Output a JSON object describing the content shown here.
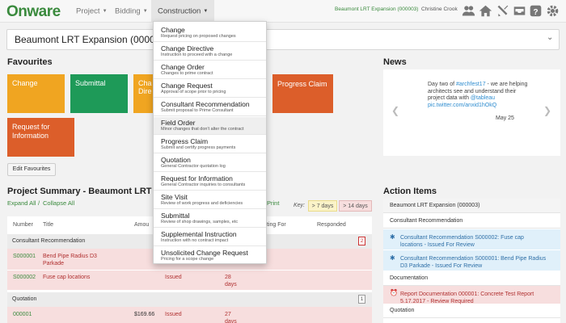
{
  "topbar": {
    "logo": "Onware",
    "nav": [
      {
        "label": "Project"
      },
      {
        "label": "Bidding"
      },
      {
        "label": "Construction"
      }
    ],
    "project_link": "Beaumont LRT Expansion (000003)",
    "user": "Christine Crook"
  },
  "project_selector": {
    "title": "Beaumont LRT Expansion (000003)"
  },
  "favourites": {
    "title": "Favourites",
    "tiles": [
      {
        "label": "Change",
        "color": "#f0a521"
      },
      {
        "label": "Submittal",
        "color": "#1e9a58"
      },
      {
        "label": "Cha Dire",
        "color": "#f0a521"
      },
      {
        "label": "Progress Claim",
        "color": "#dc5e2a"
      },
      {
        "label": "Request for Information",
        "color": "#dc5e2a"
      }
    ],
    "edit_button": "Edit Favourites"
  },
  "news": {
    "title": "News",
    "text_pre": "Day two of ",
    "hashtag": "#archfest17",
    "text_mid": " - we are helping architects see and understand their project data with ",
    "mention": "@tableau",
    "link": "pic.twitter.com/anxid1hOkQ",
    "date": "May 25"
  },
  "summary": {
    "title": "Project Summary - Beaumont LRT",
    "expand_all": "Expand All",
    "collapse_all": "Collapse All",
    "print": "Print",
    "key_label": "Key:",
    "key_7": "> 7 days",
    "key_14": "> 14 days",
    "columns": {
      "number": "Number",
      "title": "Title",
      "amount": "Amou",
      "waiting": "ting For",
      "responded": "Responded"
    },
    "groups": [
      {
        "name": "Consultant Recommendation",
        "count": "2",
        "rows": [
          {
            "number": "S000001",
            "title1": "Bend Pipe Radius D3",
            "title2": "Parkade"
          },
          {
            "number": "S000002",
            "title1": "Fuse cap locations",
            "status": "Issued",
            "days1": "28",
            "days2": "days"
          }
        ]
      },
      {
        "name": "Quotation",
        "count": "1",
        "rows": [
          {
            "number": "000001",
            "amount": "$169.66",
            "status": "Issued",
            "days1": "27",
            "days2": "days"
          }
        ]
      }
    ]
  },
  "action_items": {
    "title": "Action Items",
    "project": "Beaumont LRT Expansion (000003)",
    "sections": [
      {
        "name": "Consultant Recommendation"
      },
      {
        "name": "Documentation"
      },
      {
        "name": "Quotation"
      }
    ],
    "items": [
      {
        "line1": "Consultant Recommendation S000002: Fuse cap",
        "line2": "locations - Issued For Review"
      },
      {
        "line1": "Consultant Recommendation S000001: Bend Pipe Radius",
        "line2": "D3 Parkade - Issued For Review"
      },
      {
        "line1": "Report Documentation 000001: Concrete Test Report",
        "line2": "5.17.2017 - Review Required"
      }
    ]
  },
  "construction_menu": {
    "items": [
      {
        "title": "Change",
        "desc": "Request pricing on proposed changes"
      },
      {
        "title": "Change Directive",
        "desc": "Instruction to proceed with a change"
      },
      {
        "title": "Change Order",
        "desc": "Changes to prime contract"
      },
      {
        "title": "Change Request",
        "desc": "Approval of scope prior to pricing"
      },
      {
        "title": "Consultant Recommendation",
        "desc": "Submit proposal to Prime Consultant"
      },
      {
        "title": "Field Order",
        "desc": "Minor changes that don't alter the contract"
      },
      {
        "title": "Progress Claim",
        "desc": "Submit and certify progress payments"
      },
      {
        "title": "Quotation",
        "desc": "General Contractor quotation log"
      },
      {
        "title": "Request for Information",
        "desc": "General Contractor inquiries to consultants"
      },
      {
        "title": "Site Visit",
        "desc": "Review of work progress and deficiencies"
      },
      {
        "title": "Submittal",
        "desc": "Review of shop drawings, samples, etc"
      },
      {
        "title": "Supplemental Instruction",
        "desc": "Instruction with no contract impact"
      },
      {
        "title": "Unsolicited Change Request",
        "desc": "Pricing for a scope change"
      }
    ]
  }
}
